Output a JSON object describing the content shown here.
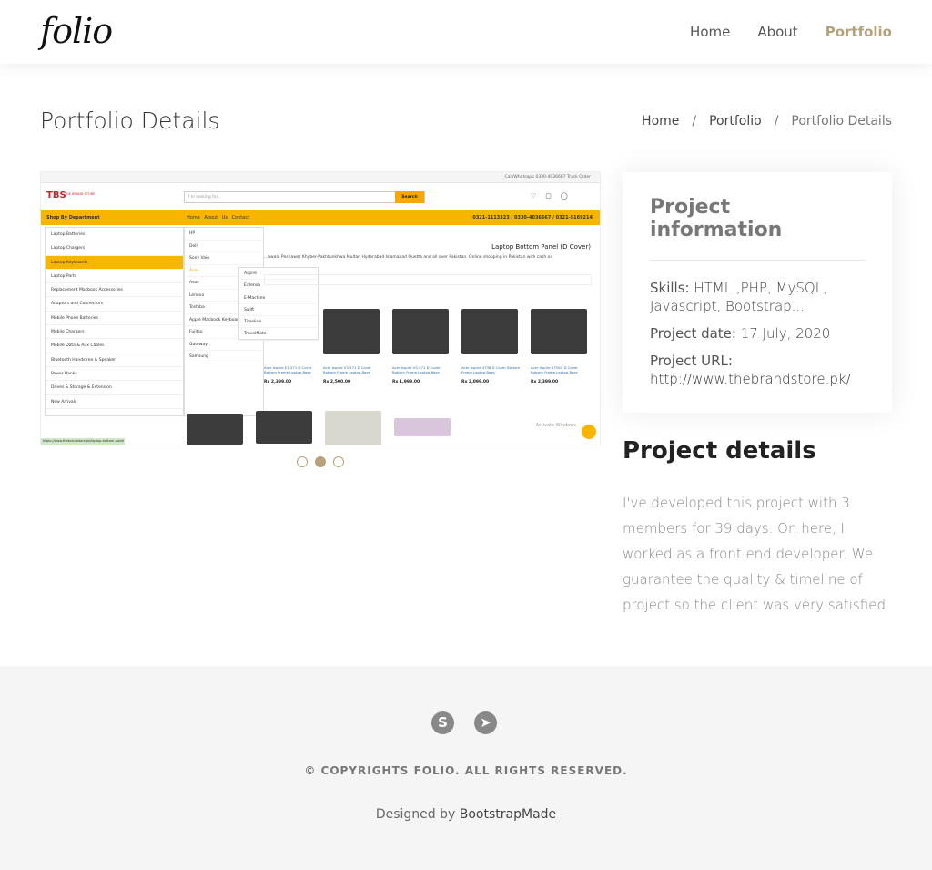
{
  "header": {
    "logo": "folio",
    "nav": [
      "Home",
      "About",
      "Portfolio"
    ]
  },
  "page": {
    "title": "Portfolio Details",
    "breadcrumb": [
      "Home",
      "Portfolio",
      "Portfolio Details"
    ]
  },
  "screenshot": {
    "topbar_right": "Call/Whatsapp 0330-4036667     Track Order",
    "brand": "TBS",
    "brand_sub": "THE BRAND STORE",
    "search_placeholder": "I'm looking for...",
    "search_button": "Search",
    "dept": "Shop By Department",
    "links": "Home  About Us  Contact",
    "phones": "0321-1113323 / 0330-4036667 / 0321-5169214",
    "menu": [
      "Laptop Batteries",
      "Laptop Chargers",
      "Laptop Keyboards",
      "Laptop Parts",
      "Replacement Macbook Accessories",
      "Adaptors and Connectors",
      "Mobile Phone Batteries",
      "Mobile Chargers",
      "Mobile Data & Aux Cables",
      "Bluetooth Handsfree & Speaker",
      "Power Banks",
      "Drives & Storage & Extension",
      "New Arrivals"
    ],
    "sub1": [
      "HP",
      "Dell",
      "Sony Vaio",
      "Acer",
      "Asus",
      "Lenovo",
      "Toshiba",
      "Apple Macbook Keyboards",
      "Fujitsu",
      "Gateway",
      "Samsung"
    ],
    "sub2": [
      "Aspire",
      "Extensa",
      "E-Machine",
      "Swift",
      "Timeline",
      "TravelMate"
    ],
    "product_title": "Laptop Bottom Panel (D Cover)",
    "product_desc": "...awala Peshawar Khyber-Pakhtunkhwa Multan Hyderabad Islamabad Quetta and all over Pakistan. Online shopping in Pakistan with cash on",
    "products": [
      {
        "name": "Acer Aspire E1-571 D Cover Bottom Frame Laptop Base",
        "price": "Rx 2,399.00"
      },
      {
        "name": "Acer Aspire V3-571 D Cover Bottom Frame Laptop Base",
        "price": "Rx 2,500.00"
      },
      {
        "name": "Acer Aspire V5-571 D Cover Bottom Frame Laptop Base",
        "price": "Rx 1,999.00"
      },
      {
        "name": "Acer Aspire 4738 D Cover Bottom Frame Laptop Base",
        "price": "Rx 2,099.00"
      },
      {
        "name": "Acer Aspire 4750G D Cover Bottom Frame Laptop Base",
        "price": "Rx 2,399.00"
      }
    ],
    "watermark": "Activate Windows",
    "status": "https://www.thebrandstore.pk/laptop-bottom-panel"
  },
  "carousel": {
    "count": 3,
    "active": 2
  },
  "info": {
    "heading": "Project information",
    "skills_label": "Skills",
    "skills": "HTML ,PHP, MySQL, Javascript, Bootstrap...",
    "date_label": "Project date",
    "date": "17 July, 2020",
    "url_label": "Project URL",
    "url": "http://www.thebrandstore.pk/"
  },
  "details": {
    "heading": "Project details",
    "text": "I've developed this project with 3 members for 39 days. On here, I worked as a front end developer. We guarantee the quality & timeline of project so the client was very satisfied."
  },
  "footer": {
    "social": [
      "S",
      "➤"
    ],
    "copyright": "© COPYRIGHTS FOLIO. ALL RIGHTS RESERVED.",
    "designed_prefix": "Designed by",
    "designed_link": "BootstrapMade"
  }
}
